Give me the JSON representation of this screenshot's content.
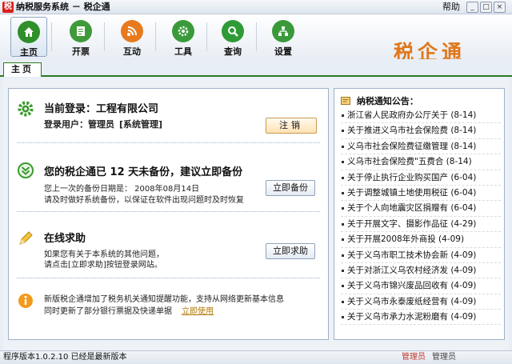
{
  "titlebar": {
    "logo_char": "税",
    "title": "纳税服务系统 － 税企通",
    "help": "帮助",
    "min": "_",
    "max": "□",
    "close": "×"
  },
  "toolbar": {
    "items": [
      {
        "label": "主页"
      },
      {
        "label": "开票"
      },
      {
        "label": "互动"
      },
      {
        "label": "工具"
      },
      {
        "label": "查询"
      },
      {
        "label": "设置"
      }
    ],
    "brand": "税企通"
  },
  "tabs": {
    "home": "主页"
  },
  "login": {
    "title": "当前登录：工程有限公司",
    "user_label": "登录用户：管理员",
    "role": "[系统管理]",
    "logout": "注销"
  },
  "backup": {
    "title": "您的税企通已 12 天未备份，建议立即备份",
    "last_date": "您上一次的备份日期是： 2008年08月14日",
    "tip": "请及时做好系统备份，以保证在软件出现问题时及时恢复",
    "button": "立即备份"
  },
  "help": {
    "title": "在线求助",
    "line1": "如果您有关于本系统的其他问题，",
    "line2": "请点击[立即求助]按钮登录网站。",
    "button": "立即求助"
  },
  "news": {
    "line1": "新版税企通增加了税务机关通知提醒功能，支持从网络更新基本信息",
    "line2": "同时更新了部分银行票据及快递单据",
    "link": "立即使用"
  },
  "notice": {
    "header": "纳税通知公告：",
    "items": [
      "浙江省人民政府办公厅关于 (8-14)",
      "关于推进义乌市社会保险费 (8-14)",
      "义乌市社会保险费征缴管理 (8-14)",
      "义乌市社会保险费\"五费合 (8-14)",
      "关于停止执行企业购买国产 (6-04)",
      "关于调整城镇土地使用税征 (6-04)",
      "关于个人向地震灾区捐赠有 (6-04)",
      "关于开展文字、摄影作品征 (4-29)",
      "关于开展2008年外商投 (4-09)",
      "关于义乌市职工技术协会新 (4-09)",
      "关于对浙江义乌农村经济发 (4-09)",
      "关于义乌市锦兴废品回收有 (4-09)",
      "关于义乌市永泰废纸经营有 (4-09)",
      "关于义乌市承力水泥粉磨有 (4-09)"
    ]
  },
  "status": {
    "version": "程序版本1.0.2.10 已经是最新版本",
    "role": "管理员",
    "role2": "管理员"
  },
  "colors": {
    "brand_orange": "#e0771a",
    "tab_green": "#2f7a20",
    "icon_home": "#2f8f2a",
    "icon_invoice": "#3f9a3a",
    "icon_interact": "#e87a1e",
    "icon_tools": "#3a9a3a",
    "icon_query": "#2f9a36",
    "icon_settings": "#3a9a3a"
  }
}
